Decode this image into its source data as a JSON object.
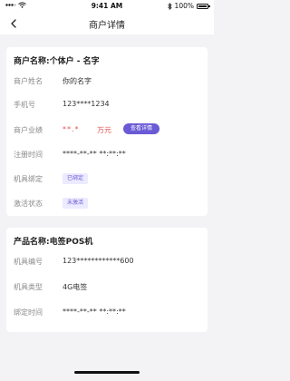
{
  "status_bar": {
    "carrier_icon": "signal-wifi-icon",
    "time": "9:41 AM",
    "battery_percent": "100%"
  },
  "nav": {
    "back_icon": "chevron-left-icon",
    "title": "商户详情"
  },
  "merchant_card": {
    "title": "商户名称:个体户 - 名字",
    "rows": [
      {
        "label": "商户姓名",
        "value": "你的名字"
      },
      {
        "label": "手机号",
        "value": "123****1234"
      },
      {
        "label": "商户业绩",
        "value": "**.*",
        "unit": "万元",
        "button": "查看详情"
      },
      {
        "label": "注册时间",
        "value": "****-**-** **:**:**"
      },
      {
        "label": "机具绑定",
        "tag": "已绑定"
      },
      {
        "label": "激活状态",
        "tag": "未激活"
      }
    ]
  },
  "product_card": {
    "title": "产品名称:电签POS机",
    "rows": [
      {
        "label": "机具编号",
        "value": "123************600"
      },
      {
        "label": "机具类型",
        "value": "4G电签"
      },
      {
        "label": "绑定时间",
        "value": "****-**-** **:**:**"
      }
    ]
  },
  "colors": {
    "accent": "#6a5ad6",
    "accent_tag_bg": "#eceaff",
    "warning_red": "#e25555",
    "page_bg": "#f3f3f6"
  }
}
